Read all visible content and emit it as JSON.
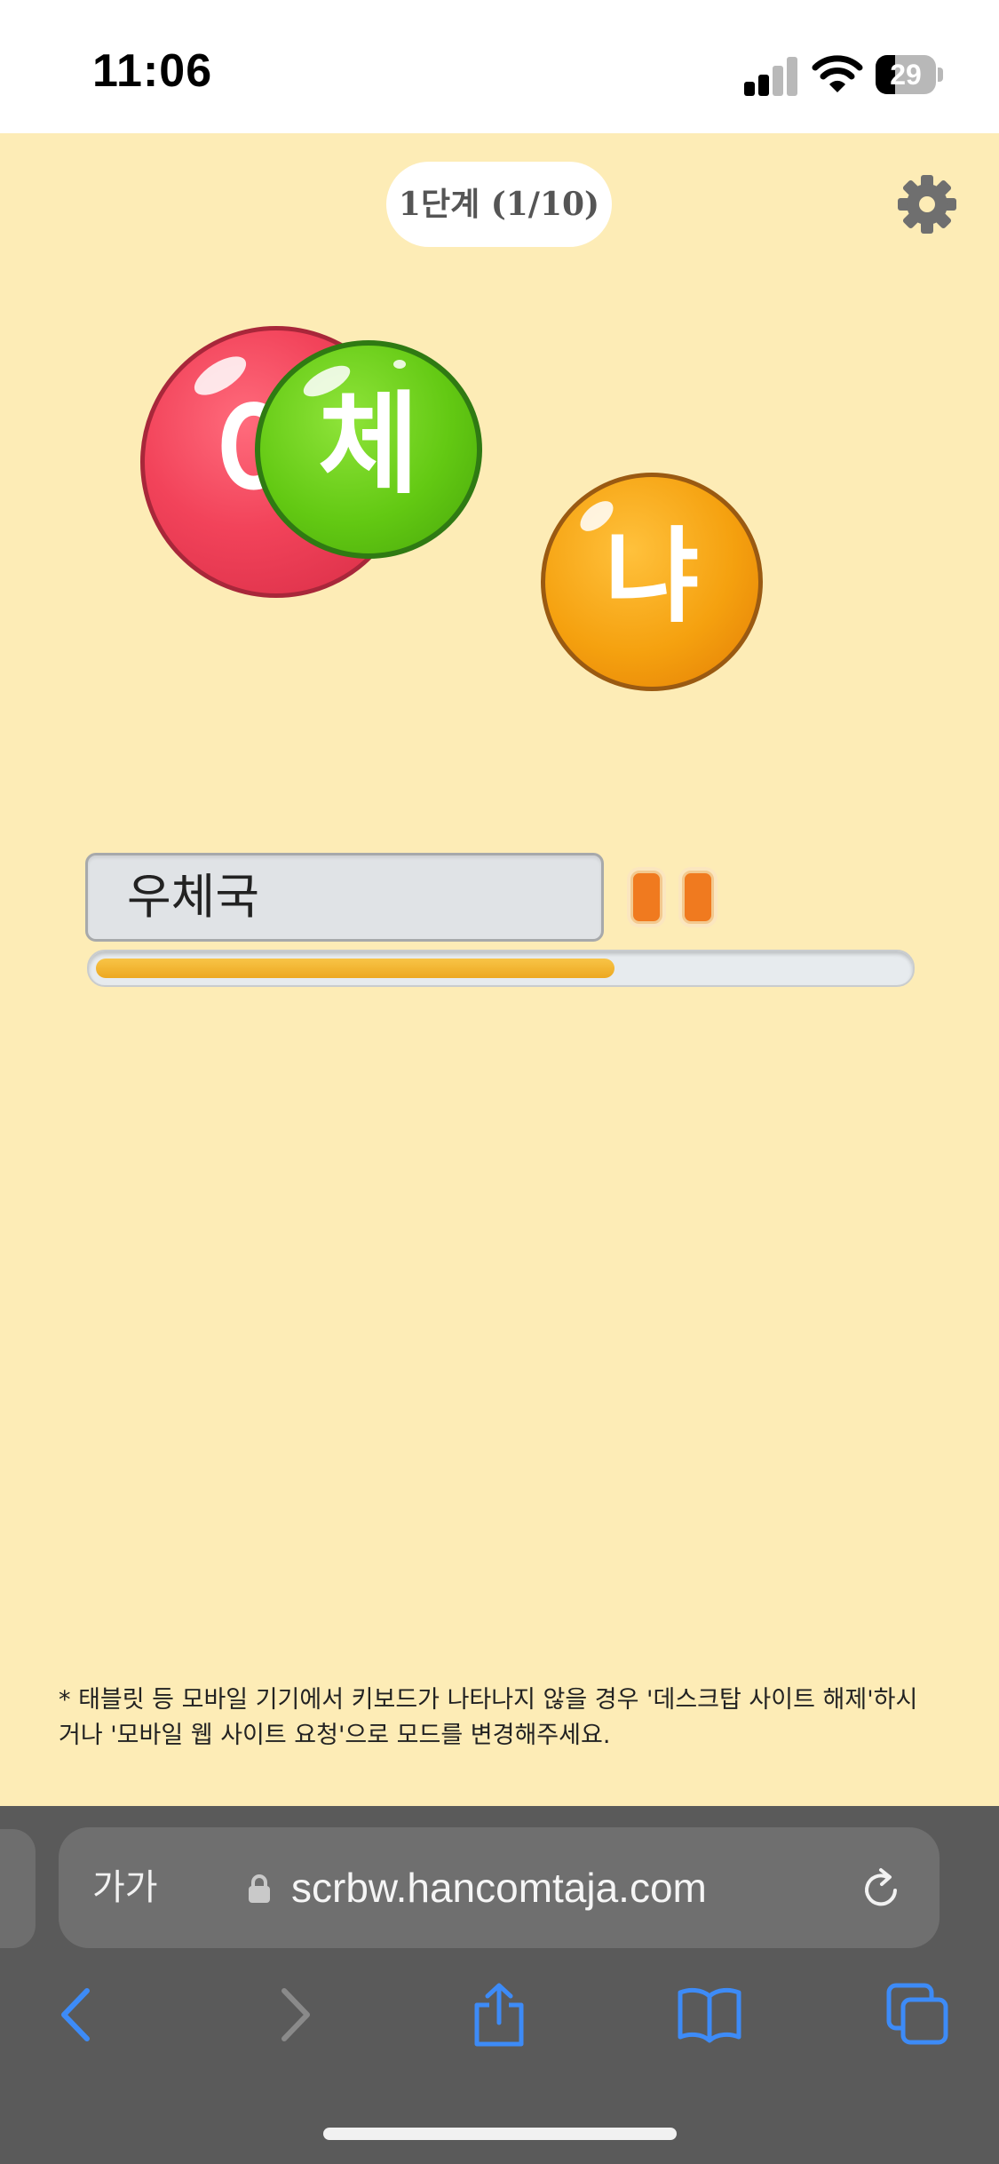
{
  "status_bar": {
    "time": "11:06",
    "battery_level": "29",
    "icons": [
      "signal-icon",
      "wifi-icon",
      "battery-icon"
    ]
  },
  "game": {
    "stage_label": "1단계 (1/10)",
    "balls": [
      {
        "char": "어",
        "color": "#f2435a"
      },
      {
        "char": "체",
        "color": "#63c913"
      },
      {
        "char": "냐",
        "color": "#f5a10f"
      }
    ],
    "input_text": "우체국",
    "lives": 2,
    "progress_fraction": 0.64,
    "notice": "* 태블릿 등 모바일 기기에서 키보드가 나타나지 않을 경우 '데스크탑 사이트 해제'하시거나 '모바일 웹 사이트 요청'으로 모드를 변경해주세요.",
    "colors": {
      "background": "#fdecb6",
      "progress": "#f2b22e"
    }
  },
  "browser": {
    "text_size_label": "가가",
    "url": "scrbw.hancomtaja.com",
    "icons": [
      "lock-icon",
      "reload-icon",
      "back-icon",
      "forward-icon",
      "share-icon",
      "bookmarks-icon",
      "tabs-icon"
    ],
    "accent": "#3d8bf7"
  }
}
